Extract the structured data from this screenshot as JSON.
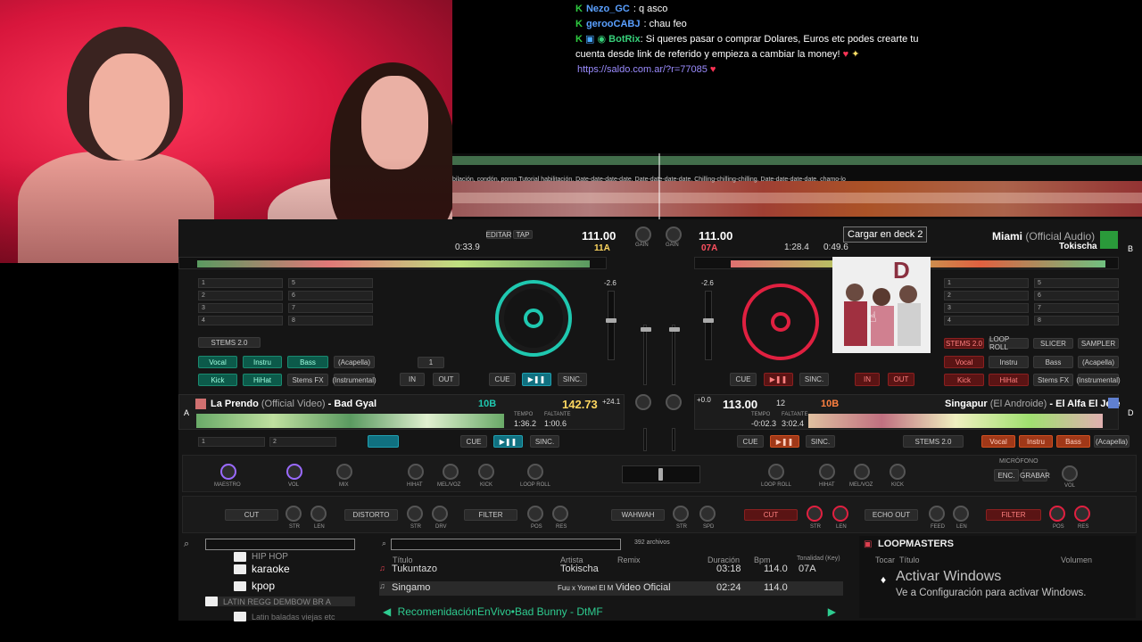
{
  "chat": {
    "lines": [
      {
        "user": "Nezo_GC",
        "user_color": "#5aa0ff",
        "text": "q asco"
      },
      {
        "user": "gerooCABJ",
        "user_color": "#5aa0ff",
        "text": "chau feo"
      },
      {
        "user": "BotRix",
        "user_color": "#37d07a",
        "text": "Si queres pasar o comprar Dolares, Euros etc podes crearte tu cuenta desde link de referido y empieza a cambiar la money!",
        "link": "https://saldo.com.ar/?r=77085"
      }
    ]
  },
  "overview": {
    "lyrics_text": "bilación, condón, porno Tutorial habilitación. Date-date-date-date. Date-date-date-date. Chilling-chilling-chilling. Date-date-date-date.  chamo-lo"
  },
  "deck1": {
    "time_elapsed": "0:33.9",
    "edit_btn": "EDITAR",
    "tap_btn": "TAP",
    "bpm": "111.00",
    "key": "11A",
    "pitch": "-2.6",
    "hotcues": [
      "1",
      "2",
      "3",
      "4",
      "5",
      "6",
      "7",
      "8"
    ],
    "stems_label": "STEMS 2.0",
    "stem_buttons": [
      "Vocal",
      "Instru",
      "Bass",
      "(Acapella)",
      "Kick",
      "HiHat",
      "Stems FX",
      "(Instrumental)"
    ],
    "loop_size": "1",
    "in_btn": "IN",
    "out_btn": "OUT",
    "cue_btn": "CUE",
    "sync_btn": "SINC."
  },
  "deck2": {
    "bpm": "111.00",
    "key": "07A",
    "time_elapsed": "1:28.4",
    "time_remaining": "0:49.6",
    "title": "Miami",
    "title_suffix": "(Official Audio)",
    "artist": "Tokischa",
    "letter": "B",
    "pitch": "-2.6",
    "hotcues": [
      "1",
      "2",
      "3",
      "4",
      "5",
      "6",
      "7",
      "8"
    ],
    "pad_modes": [
      "STEMS 2.0",
      "LOOP ROLL",
      "SLICER",
      "SAMPLER"
    ],
    "stem_buttons": [
      "Vocal",
      "Instru",
      "Bass",
      "(Acapella)",
      "Kick",
      "HiHat",
      "Stems FX",
      "(Instrumental)"
    ],
    "in_btn": "IN",
    "out_btn": "OUT",
    "cue_btn": "CUE",
    "sync_btn": "SINC."
  },
  "tooltip": "Cargar en deck 2",
  "deckA": {
    "letter": "A",
    "title": "La Prendo",
    "title_suffix": "(Official Video)",
    "artist": "Bad Gyal",
    "key": "10B",
    "bpm": "142.73",
    "pitch": "+24.1",
    "tempo_label": "TEMPO",
    "tempo": "1:36.2",
    "remaining_label": "FALTANTE",
    "remaining": "1:00.6",
    "slots": [
      "1",
      "2"
    ],
    "cue_btn": "CUE",
    "sync_btn": "SINC."
  },
  "deckD": {
    "letter": "D",
    "bpm": "113.00",
    "pitch_val": "12",
    "key": "10B",
    "pitch": "+0.0",
    "tempo_label": "TEMPO",
    "tempo": "-0:02.3",
    "remaining_label": "FALTANTE",
    "remaining": "3:02.4",
    "title": "Singapur",
    "title_suffix": "(El Androide)",
    "artist": "El Alfa El Jefe",
    "cue_btn": "CUE",
    "sync_btn": "SINC.",
    "stems_label": "STEMS 2.0",
    "stem_buttons": [
      "Vocal",
      "Instru",
      "Bass",
      "(Acapella)"
    ]
  },
  "fx": {
    "row1_left": [
      "MAESTRO",
      "VOL",
      "MIX"
    ],
    "row1_mid_left": [
      "HIHAT",
      "MEL/VOZ",
      "KICK",
      "LOOP ROLL"
    ],
    "row1_mid_right": [
      "LOOP ROLL",
      "HIHAT",
      "MEL/VOZ",
      "KICK"
    ],
    "mic_label": "MICRÓFONO",
    "mic_buttons": [
      "ENC.",
      "GRABAR"
    ],
    "mic_vol": "VOL",
    "row2_left_fx1": "CUT",
    "row2_left_fx2": "DISTORTO",
    "row2_left_fx3": "FILTER",
    "row2_center_fx": "WAHWAH",
    "row2_right_fx1": "CUT",
    "row2_right_fx2": "ECHO OUT",
    "row2_right_fx3": "FILTER",
    "knob_labels_left": [
      "STR",
      "LEN",
      "STR",
      "DRV",
      "POS",
      "RES"
    ],
    "knob_labels_center": [
      "STR",
      "SPD"
    ],
    "knob_labels_right": [
      "STR",
      "LEN",
      "FEED",
      "LEN",
      "POS",
      "RES"
    ]
  },
  "browser": {
    "file_count": "392 archivos",
    "folders": [
      "HIP HOP",
      "karaoke",
      "kpop",
      "LATIN REGG DEMBOW BR A",
      "Latin baladas viejas etc"
    ],
    "columns": [
      "Título",
      "Artista",
      "Remix",
      "Duración",
      "Bpm",
      "Tonalidad (Key)"
    ],
    "rows": [
      {
        "title": "Tukuntazo",
        "artist": "Tokischa",
        "remix": "",
        "duration": "03:18",
        "bpm": "114.0",
        "key": "07A"
      },
      {
        "title": "Singamo",
        "artist": "Fuu x Yomel El M",
        "remix": "Video Oficial",
        "duration": "02:24",
        "bpm": "114.0",
        "key": ""
      }
    ],
    "recommendation": "RecomenidaciónEnVivo•Bad Bunny - DtMF"
  },
  "loopmasters": {
    "title": "LOOPMASTERS",
    "col_play": "Tocar",
    "col_title": "Título",
    "col_volume": "Volumen"
  },
  "windows": {
    "title": "Activar Windows",
    "subtitle": "Ve a Configuración para activar Windows."
  },
  "colors": {
    "accent_teal": "#1fc8b0",
    "accent_red": "#e02040",
    "chat_green": "#2ecc40",
    "link": "#9b8cff"
  }
}
